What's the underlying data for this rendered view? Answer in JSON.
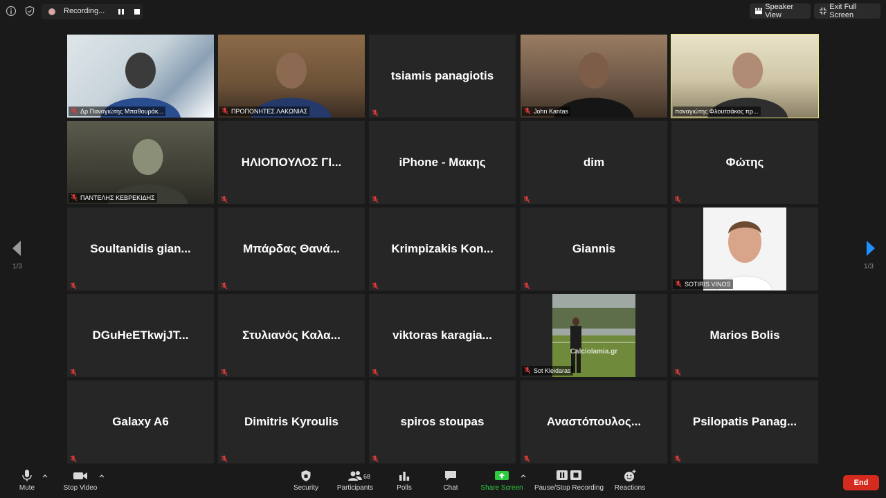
{
  "recording": {
    "label": "Recording..."
  },
  "top_buttons": {
    "speaker_view": "Speaker View",
    "exit_full_screen": "Exit Full Screen"
  },
  "pagination": {
    "left": "1/3",
    "right": "1/3"
  },
  "tiles": [
    {
      "name": "",
      "label": "Δρ Παναγιώτης Μπαθουράκ...",
      "video": true
    },
    {
      "name": "",
      "label": "ΠΡΟΠΟΝΗΤΕΣ ΛΑΚΩΝΙΑΣ",
      "video": true
    },
    {
      "name": "tsiamis panagiotis",
      "label": "",
      "video": false
    },
    {
      "name": "",
      "label": "John Kantas",
      "video": true
    },
    {
      "name": "",
      "label": "παναγιώτης Φλουτσάκος πρ...",
      "video": true
    },
    {
      "name": "",
      "label": "ΠΑΝΤΕΛΗΣ ΚΕΒΡΕΚΙΔΗΣ",
      "video": true
    },
    {
      "name": "ΗΛΙΟΠΟΥΛΟΣ ΓΙ...",
      "label": "",
      "video": false
    },
    {
      "name": "iPhone - Μακης",
      "label": "",
      "video": false
    },
    {
      "name": "dim",
      "label": "",
      "video": false
    },
    {
      "name": "Φώτης",
      "label": "",
      "video": false
    },
    {
      "name": "Soultanidis gian...",
      "label": "",
      "video": false
    },
    {
      "name": "Μπάρδας Θανά...",
      "label": "",
      "video": false
    },
    {
      "name": "Krimpizakis Kon...",
      "label": "",
      "video": false
    },
    {
      "name": "Giannis",
      "label": "",
      "video": false
    },
    {
      "name": "",
      "label": "SOTIRIS VINOS",
      "video": true
    },
    {
      "name": "DGuHeETkwjJT...",
      "label": "",
      "video": false
    },
    {
      "name": "Στυλιανός Καλα...",
      "label": "",
      "video": false
    },
    {
      "name": "viktoras karagia...",
      "label": "",
      "video": false
    },
    {
      "name": "",
      "label": "Sot Kleidaras",
      "video": true,
      "watermark": "Calciolamia.gr"
    },
    {
      "name": "Marios Bolis",
      "label": "",
      "video": false
    },
    {
      "name": "Galaxy A6",
      "label": "",
      "video": false
    },
    {
      "name": "Dimitris Kyroulis",
      "label": "",
      "video": false
    },
    {
      "name": "spiros stoupas",
      "label": "",
      "video": false
    },
    {
      "name": "Αναστόπουλος...",
      "label": "",
      "video": false
    },
    {
      "name": "Psilopatis Panag...",
      "label": "",
      "video": false
    }
  ],
  "toolbar": {
    "mute": "Mute",
    "stop_video": "Stop Video",
    "security": "Security",
    "participants": "Participants",
    "participants_count": "68",
    "polls": "Polls",
    "chat": "Chat",
    "share_screen": "Share Screen",
    "pause_stop_recording": "Pause/Stop Recording",
    "reactions": "Reactions",
    "end": "End"
  },
  "colors": {
    "share_green": "#2ecc40",
    "end_red": "#d52b1e",
    "active_speaker": "#e6e87a",
    "arrow_blue": "#1e90ff"
  }
}
